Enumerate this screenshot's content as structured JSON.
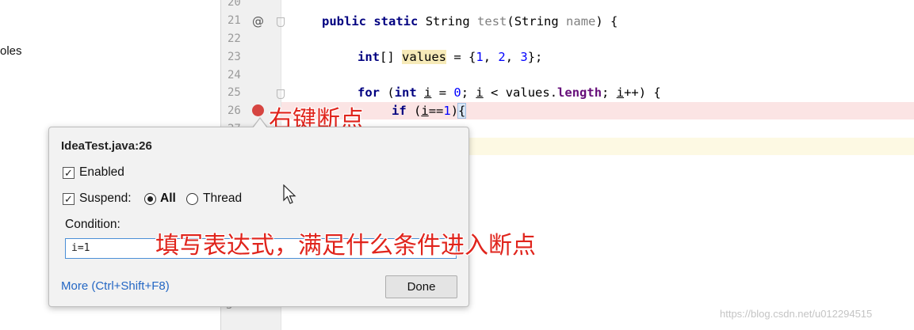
{
  "project_panel": {
    "partial_item": "oles"
  },
  "gutter": {
    "line_numbers": [
      "20",
      "21",
      "22",
      "23",
      "24",
      "25",
      "26",
      "27"
    ],
    "bottom_partial": "3"
  },
  "code": {
    "line21": {
      "kw1": "public",
      "kw2": "static",
      "type": "String",
      "method": "test",
      "paren_open": "(",
      "ptype": "String",
      "pname": "name",
      "tail": ") {"
    },
    "line23": {
      "kw": "int",
      "brackets": "[]",
      "var": "values",
      "eq": " = {",
      "n1": "1",
      "c1": ", ",
      "n2": "2",
      "c2": ", ",
      "n3": "3",
      "end": "};"
    },
    "line25": {
      "kw1": "for",
      "p1": " (",
      "kw2": "int",
      "i1": "i",
      "p2": " = ",
      "n0": "0",
      "p3": "; ",
      "i2": "i",
      "p4": " < values.",
      "field": "length",
      "p5": "; ",
      "i3": "i",
      "p6": "++) {"
    },
    "line26": {
      "kw": "if",
      "p1": " (",
      "i": "i",
      "p2": "==",
      "n1": "1",
      "p3": ")",
      "brace": "{"
    }
  },
  "annotations": {
    "right_click": "右键断点",
    "condition_hint": "填写表达式，满足什么条件进入断点"
  },
  "breakpoint_popup": {
    "title": "IdeaTest.java:26",
    "enabled_label": "Enabled",
    "enabled_checked": true,
    "suspend_label": "Suspend:",
    "suspend_checked": true,
    "radio_all": "All",
    "radio_thread": "Thread",
    "selected_policy": "All",
    "condition_label": "Condition:",
    "condition_value": "i=1",
    "more_link": "More (Ctrl+Shift+F8)",
    "done_button": "Done"
  },
  "watermark": "https://blog.csdn.net/u012294515",
  "colors": {
    "breakpoint": "#d64541",
    "breakpoint_line_bg": "#fbe4e4",
    "annotation_text": "#e0241c",
    "keyword": "#000080",
    "link": "#2467c4"
  }
}
